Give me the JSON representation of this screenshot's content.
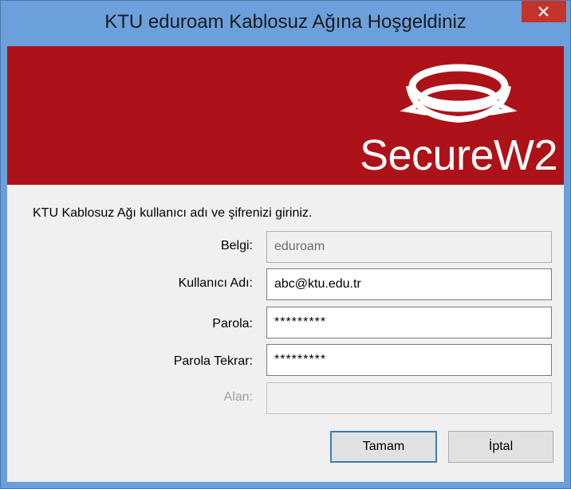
{
  "window": {
    "title": "KTU eduroam Kablosuz Ağına Hoşgeldiniz",
    "close_label": "×"
  },
  "banner": {
    "logo_text": "SecureW2",
    "background_color": "#ad1219"
  },
  "form": {
    "instruction": "KTU Kablosuz Ağı kullanıcı adı ve şifrenizi giriniz.",
    "belgi": {
      "label": "Belgi:",
      "value": "eduroam",
      "state": "read-only"
    },
    "username": {
      "label": "Kullanıcı Adı:",
      "value": "abc@ktu.edu.tr"
    },
    "password": {
      "label": "Parola:",
      "value": "*********"
    },
    "password_confirm": {
      "label": "Parola Tekrar:",
      "value": "*********"
    },
    "domain": {
      "label": "Alan:",
      "value": "",
      "state": "disabled"
    }
  },
  "buttons": {
    "ok_label": "Tamam",
    "cancel_label": "İptal"
  }
}
